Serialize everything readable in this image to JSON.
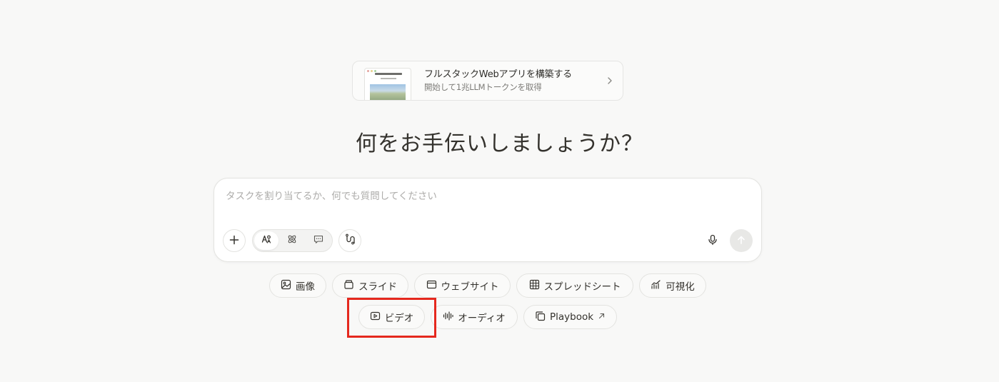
{
  "promo": {
    "title": "フルスタックWebアプリを構築する",
    "subtitle": "開始して1兆LLMトークンを取得"
  },
  "heading": "何をお手伝いしましょうか？",
  "composer": {
    "placeholder": "タスクを割り当てるか、何でも質問してください",
    "value": "",
    "active_mode": "agent"
  },
  "chips": {
    "image": "画像",
    "slides": "スライド",
    "website": "ウェブサイト",
    "spreadsheet": "スプレッドシート",
    "visualize": "可視化",
    "video": "ビデオ",
    "audio": "オーディオ",
    "playbook": "Playbook"
  },
  "icons": {
    "add": "plus-icon",
    "agent": "agent-mode-icon",
    "adaptive": "atom-icon",
    "chat": "chat-icon",
    "connectors": "connector-icon",
    "mic": "microphone-icon",
    "send": "arrow-up-icon"
  },
  "colors": {
    "background": "#f8f8f7",
    "highlight": "#e5281e"
  }
}
